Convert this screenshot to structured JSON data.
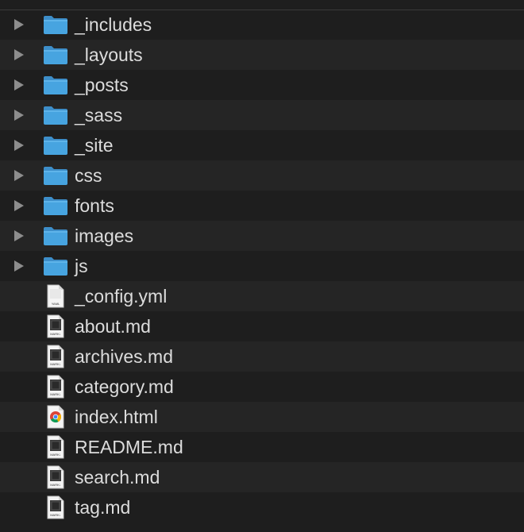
{
  "colors": {
    "background": "#1e1e1e",
    "row_alt": "#252525",
    "text": "#dcdcdc",
    "folder": "#47a4e0",
    "disclosure": "#8d8d8d"
  },
  "items": [
    {
      "name": "_includes",
      "kind": "folder"
    },
    {
      "name": "_layouts",
      "kind": "folder"
    },
    {
      "name": "_posts",
      "kind": "folder"
    },
    {
      "name": "_sass",
      "kind": "folder"
    },
    {
      "name": "_site",
      "kind": "folder"
    },
    {
      "name": "css",
      "kind": "folder"
    },
    {
      "name": "fonts",
      "kind": "folder"
    },
    {
      "name": "images",
      "kind": "folder"
    },
    {
      "name": "js",
      "kind": "folder"
    },
    {
      "name": "_config.yml",
      "kind": "file",
      "icon": "yaml-file-icon",
      "icon_label": "YAML"
    },
    {
      "name": "about.md",
      "kind": "file",
      "icon": "markdown-file-icon",
      "icon_label": "MARK↓"
    },
    {
      "name": "archives.md",
      "kind": "file",
      "icon": "markdown-file-icon",
      "icon_label": "MARK↓"
    },
    {
      "name": "category.md",
      "kind": "file",
      "icon": "markdown-file-icon",
      "icon_label": "MARK↓"
    },
    {
      "name": "index.html",
      "kind": "file",
      "icon": "chrome-html-file-icon"
    },
    {
      "name": "README.md",
      "kind": "file",
      "icon": "markdown-file-icon",
      "icon_label": "MARK↓"
    },
    {
      "name": "search.md",
      "kind": "file",
      "icon": "markdown-file-icon",
      "icon_label": "MARK↓"
    },
    {
      "name": "tag.md",
      "kind": "file",
      "icon": "markdown-file-icon",
      "icon_label": "MARK↓"
    }
  ]
}
